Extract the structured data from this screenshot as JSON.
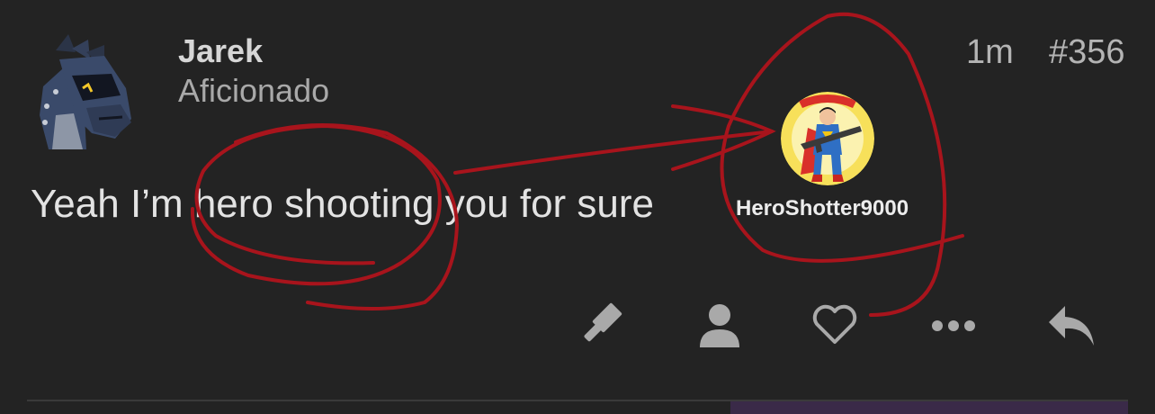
{
  "post": {
    "author": {
      "name": "Jarek",
      "title": "Aficionado"
    },
    "time": "1m",
    "number": "#356",
    "body": "Yeah I’m hero shooting you for sure",
    "embed": {
      "username": "HeroShotter9000"
    }
  },
  "actions": [
    {
      "icon": "gavel-icon"
    },
    {
      "icon": "user-icon"
    },
    {
      "icon": "heart-icon"
    },
    {
      "icon": "more-icon"
    },
    {
      "icon": "reply-icon"
    }
  ],
  "colors": {
    "background": "#232323",
    "annotation": "#a8141c",
    "icon": "#a9a9a9",
    "accent": "#3a2a48"
  }
}
